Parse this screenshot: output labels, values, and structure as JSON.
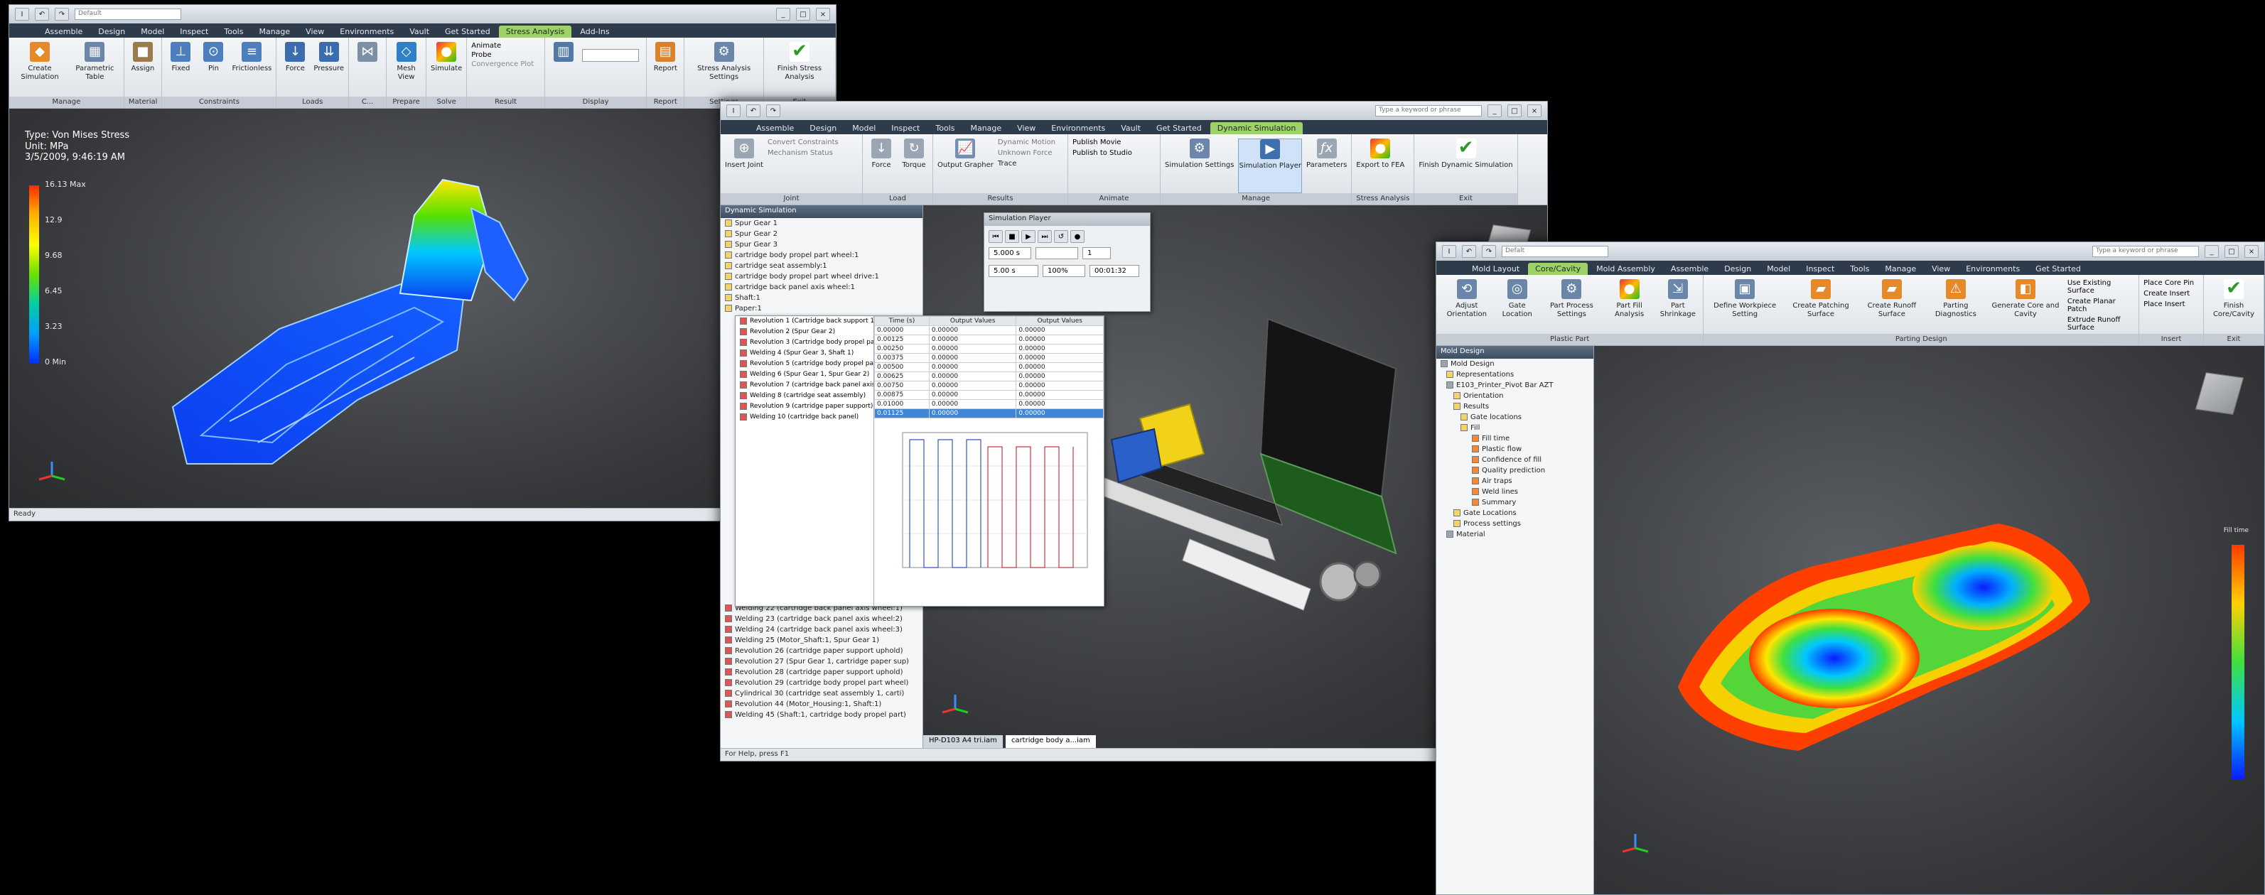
{
  "window1": {
    "title_input": "Default",
    "tabs": [
      "Assemble",
      "Design",
      "Model",
      "Inspect",
      "Tools",
      "Manage",
      "View",
      "Environments",
      "Vault",
      "Get Started",
      "Stress Analysis",
      "Add-Ins"
    ],
    "active_tab": "Stress Analysis",
    "panels": [
      {
        "title": "Manage",
        "buttons": [
          "Create Simulation",
          "Parametric Table"
        ]
      },
      {
        "title": "Material",
        "buttons": [
          "Assign"
        ]
      },
      {
        "title": "Constraints",
        "buttons": [
          "Fixed",
          "Pin",
          "Frictionless"
        ]
      },
      {
        "title": "Loads",
        "buttons": [
          "Force",
          "Pressure"
        ]
      },
      {
        "title": "C...",
        "buttons": [
          ""
        ]
      },
      {
        "title": "Prepare",
        "buttons": [
          "Mesh View"
        ]
      },
      {
        "title": "Solve",
        "buttons": [
          "Simulate"
        ]
      },
      {
        "title": "Result",
        "buttons": [
          "Animate",
          "Probe",
          "Convergence Plot"
        ]
      },
      {
        "title": "Display",
        "buttons": [
          ""
        ]
      },
      {
        "title": "Report",
        "buttons": [
          "Report"
        ]
      },
      {
        "title": "Settings",
        "buttons": [
          "Stress Analysis Settings"
        ]
      },
      {
        "title": "Exit",
        "buttons": [
          "Finish Stress Analysis"
        ]
      }
    ],
    "legend": {
      "type": "Type: Von Mises Stress",
      "unit": "Unit: MPa",
      "date": "3/5/2009, 9:46:19 AM",
      "max": "16.13 Max",
      "ticks": [
        "12.9",
        "9.68",
        "6.45",
        "3.23"
      ],
      "min": "0 Min"
    },
    "status": "Ready"
  },
  "window2": {
    "search": "Type a keyword or phrase",
    "tabs": [
      "Assemble",
      "Design",
      "Model",
      "Inspect",
      "Tools",
      "Manage",
      "View",
      "Environments",
      "Vault",
      "Get Started",
      "Dynamic Simulation"
    ],
    "active_tab": "Dynamic Simulation",
    "panels": [
      {
        "title": "Joint",
        "buttons": [
          "Insert Joint",
          "Convert Constraints",
          "Mechanism Status"
        ]
      },
      {
        "title": "Load",
        "buttons": [
          "Force",
          "Torque"
        ]
      },
      {
        "title": "Results",
        "buttons": [
          "Output Grapher",
          "Dynamic Motion",
          "Unknown Force",
          "Trace"
        ]
      },
      {
        "title": "Animate",
        "buttons": [
          "Publish Movie",
          "Publish to Studio"
        ]
      },
      {
        "title": "Manage",
        "buttons": [
          "Simulation Settings",
          "Simulation Player",
          "Parameters"
        ]
      },
      {
        "title": "Stress Analysis",
        "buttons": [
          "Export to FEA"
        ]
      },
      {
        "title": "Exit",
        "buttons": [
          "Finish Dynamic Simulation"
        ]
      }
    ],
    "browser_title": "Dynamic Simulation",
    "browser_items": [
      "Spur Gear 1",
      "Spur Gear 2",
      "Spur Gear 3",
      "cartridge body propel part wheel:1",
      "cartridge seat assembly:1",
      "cartridge body propel part wheel drive:1",
      "cartridge back panel axis wheel:1",
      "Shaft:1",
      "Paper:1"
    ],
    "player": {
      "title": "Simulation Player",
      "time": "5.000 s",
      "fields": [
        "5.00 s",
        "100%",
        "00:01:32"
      ],
      "count": "1"
    },
    "grapher_cols": [
      "Time (s)",
      "Output Values",
      "Output Values"
    ],
    "grapher_rows": [
      [
        "0.00000",
        "0.00000",
        "0.00000"
      ],
      [
        "0.00125",
        "0.00000",
        "0.00000"
      ],
      [
        "0.00250",
        "0.00000",
        "0.00000"
      ],
      [
        "0.00375",
        "0.00000",
        "0.00000"
      ],
      [
        "0.00500",
        "0.00000",
        "0.00000"
      ],
      [
        "0.00625",
        "0.00000",
        "0.00000"
      ],
      [
        "0.00750",
        "0.00000",
        "0.00000"
      ],
      [
        "0.00875",
        "0.00000",
        "0.00000"
      ],
      [
        "0.01000",
        "0.00000",
        "0.00000"
      ],
      [
        "0.01125",
        "0.00000",
        "0.00000"
      ]
    ],
    "grapher_list": [
      "Revolution 1 (Cartridge back support 1, Spur Gear 1)",
      "Revolution 2 (Spur Gear 2)",
      "Revolution 3 (Cartridge body propel part)",
      "Welding 4 (Spur Gear 3, Shaft 1)",
      "Revolution 5 (cartridge body propel part)",
      "Welding 6 (Spur Gear 1, Spur Gear 2)",
      "Revolution 7 (cartridge back panel axis)",
      "Welding 8 (cartridge seat assembly)",
      "Revolution 9 (cartridge paper support)",
      "Welding 10 (cartridge back panel)"
    ],
    "bottom_list": [
      "Welding 22 (cartridge back panel axis wheel:1)",
      "Welding 23 (cartridge back panel axis wheel:2)",
      "Welding 24 (cartridge back panel axis wheel:3)",
      "Welding 25 (Motor_Shaft:1, Spur Gear 1)",
      "Revolution 26 (cartridge paper support uphold)",
      "Revolution 27 (Spur Gear 1, cartridge paper sup)",
      "Revolution 28 (cartridge paper support uphold)",
      "Revolution 29 (cartridge body propel part wheel)",
      "Cylindrical 30 (cartridge seat assembly 1, carti)",
      "Revolution 44 (Motor_Housing:1, Shaft:1)",
      "Welding 45 (Shaft:1, cartridge body propel part)"
    ],
    "doc_tabs": [
      "HP-D103 A4 tri.iam",
      "cartridge body a...iam"
    ],
    "status": "For Help, press F1"
  },
  "window3": {
    "title_input": "Defalt",
    "search": "Type a keyword or phrase",
    "tabs": [
      "Mold Layout",
      "Core/Cavity",
      "Mold Assembly",
      "Assemble",
      "Design",
      "Model",
      "Inspect",
      "Tools",
      "Manage",
      "View",
      "Environments",
      "Get Started"
    ],
    "active_tab": "Core/Cavity",
    "panels": [
      {
        "title": "Plastic Part",
        "buttons": [
          "Adjust Orientation",
          "Gate Location",
          "Part Process Settings",
          "Part Fill Analysis",
          "Part Shrinkage"
        ]
      },
      {
        "title": "Parting Design",
        "buttons": [
          "Define Workpiece Setting",
          "Create Patching Surface",
          "Create Runoff Surface",
          "Parting Diagnostics",
          "Generate Core and Cavity",
          "Use Existing Surface",
          "Create Planar Patch",
          "Extrude Runoff Surface"
        ]
      },
      {
        "title": "Insert",
        "buttons": [
          "Place Core Pin",
          "Create Insert",
          "Place Insert"
        ]
      },
      {
        "title": "Exit",
        "buttons": [
          "Finish Core/Cavity"
        ]
      }
    ],
    "browser_title": "Mold Design",
    "tree": [
      "Mold Design",
      "Representations",
      "E103_Printer_Pivot Bar AZT",
      "Orientation",
      "Results",
      "Gate locations",
      "Fill",
      "Fill time",
      "Plastic flow",
      "Confidence of fill",
      "Quality prediction",
      "Air traps",
      "Weld lines",
      "Summary",
      "Gate Locations",
      "Process settings",
      "Material"
    ],
    "scale_title": "Fill time"
  },
  "colors": {
    "active_tab": "#9dd16a",
    "ribbon_bar": "#2d3b4a"
  }
}
